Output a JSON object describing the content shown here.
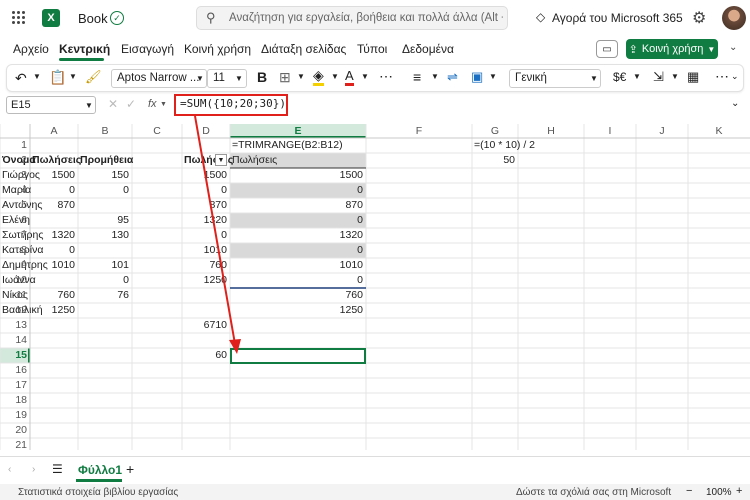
{
  "titlebar": {
    "app_name": "Book",
    "search_placeholder": "Αναζήτηση για εργαλεία, βοήθεια και πολλά άλλα (Alt + X)",
    "buy_label": "Αγορά του Microsoft 365"
  },
  "menu": {
    "items": [
      "Αρχείο",
      "Κεντρική",
      "Εισαγωγή",
      "Κοινή χρήση",
      "Διάταξη σελίδας",
      "Τύποι",
      "Δεδομένα"
    ],
    "active": "Κεντρική",
    "share_label": "Κοινή χρήση"
  },
  "ribbon": {
    "font_name": "Aptos Narrow ...",
    "font_size": "11",
    "number_format": "Γενική",
    "currency_symbol": "$€"
  },
  "formula_bar": {
    "name_box": "E15",
    "fx": "fx",
    "formula": "=SUM({10;20;30})"
  },
  "columns": [
    "A",
    "B",
    "C",
    "D",
    "E",
    "F",
    "G",
    "H",
    "I",
    "J",
    "K"
  ],
  "rows": [
    "1",
    "2",
    "3",
    "4",
    "5",
    "6",
    "7",
    "8",
    "9",
    "10",
    "11",
    "12",
    "13",
    "14",
    "15",
    "16",
    "17",
    "18",
    "19",
    "20",
    "21"
  ],
  "table": {
    "headers": {
      "name": "Όνομα",
      "sales": "Πωλήσεις",
      "commission": "Προμήθεια"
    },
    "names": [
      "Γιώργος",
      "Μαρία",
      "Αντώνης",
      "Ελένη",
      "Σωτήρης",
      "Κατερίνα",
      "Δημήτρης",
      "Ιωάννα",
      "Νίκος",
      "Βασιλική"
    ],
    "sales": [
      "1500",
      "0",
      "870",
      "",
      "1320",
      "0",
      "1010",
      "",
      "760",
      "1250"
    ],
    "commission": [
      "150",
      "0",
      "",
      "95",
      "130",
      "",
      "101",
      "0",
      "76",
      ""
    ]
  },
  "colE": {
    "header": "Πωλήσεις",
    "values": [
      "1500",
      "0",
      "870",
      "1320",
      "0",
      "1010",
      "760",
      "1250"
    ],
    "total": "6710",
    "e15": "60"
  },
  "colF": {
    "formula_note": "=TRIMRANGE(B2:B12)",
    "header": "Πωλήσεις",
    "values": [
      "1500",
      "0",
      "870",
      "0",
      "1320",
      "0",
      "1010",
      "0",
      "760",
      "1250"
    ]
  },
  "colH": {
    "formula_note": "=(10 * 10) / 2",
    "value": "50"
  },
  "sheet": {
    "tab": "Φύλλο1"
  },
  "status": {
    "left": "Στατιστικά στοιχεία βιβλίου εργασίας",
    "feedback": "Δώστε τα σχόλιά σας στη Microsoft",
    "zoom": "100%"
  },
  "colors": {
    "excel_green": "#107c41",
    "annotation_red": "#e0201b",
    "selected_header": "#d2e9dc",
    "band": "#d9d9d9"
  }
}
